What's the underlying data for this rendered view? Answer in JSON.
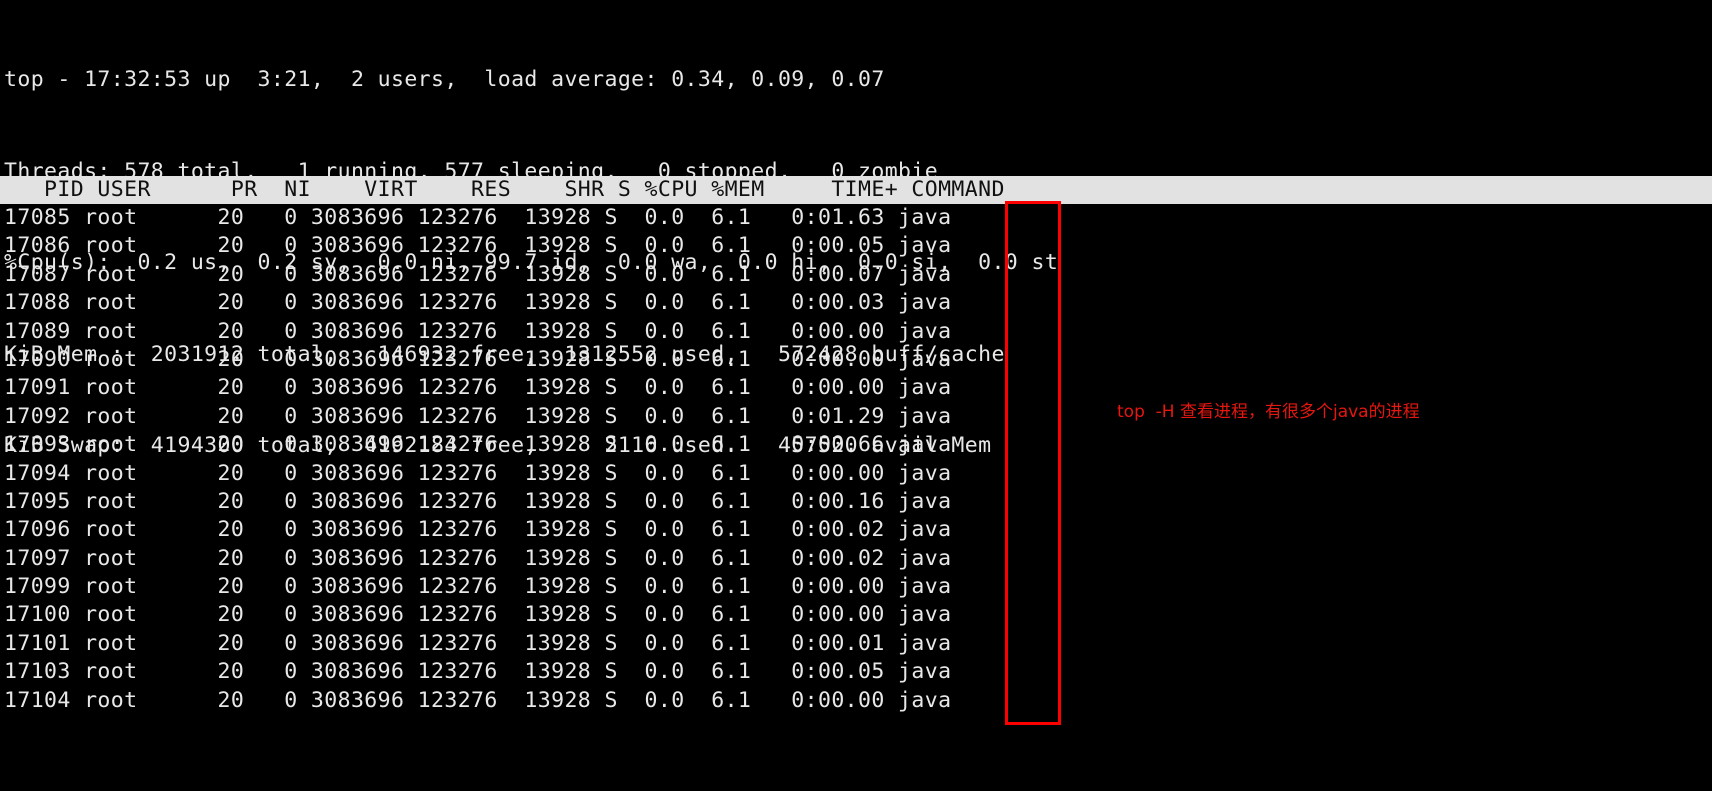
{
  "terminal": {
    "summary_lines": [
      "top - 17:32:53 up  3:21,  2 users,  load average: 0.34, 0.09, 0.07",
      "Threads: 578 total,   1 running, 577 sleeping,   0 stopped,   0 zombie",
      "%Cpu(s):  0.2 us,  0.2 sy,  0.0 ni, 99.7 id,  0.0 wa,  0.0 hi,  0.0 si,  0.0 st",
      "KiB Mem :  2031912 total,   146932 free,  1312552 used,   572428 buff/cache",
      "KiB Swap:  4194300 total,  4192184 free,     2116 used.   457520 avail Mem"
    ],
    "summary_detail": {
      "time": "17:32:53",
      "uptime": "3:21",
      "users": "2 users",
      "load_average": [
        "0.34",
        "0.09",
        "0.07"
      ],
      "threads": {
        "total": "578",
        "running": "1",
        "sleeping": "577",
        "stopped": "0",
        "zombie": "0"
      },
      "cpu": {
        "us": "0.2",
        "sy": "0.2",
        "ni": "0.0",
        "id": "99.7",
        "wa": "0.0",
        "hi": "0.0",
        "si": "0.0",
        "st": "0.0"
      },
      "mem": {
        "total": "2031912",
        "free": "146932",
        "used": "1312552",
        "buff_cache": "572428"
      },
      "swap": {
        "total": "4194300",
        "free": "4192184",
        "used": "2116",
        "avail_mem": "457520"
      }
    },
    "column_header": "   PID USER      PR  NI    VIRT    RES    SHR S %CPU %MEM     TIME+ COMMAND",
    "columns": [
      "PID",
      "USER",
      "PR",
      "NI",
      "VIRT",
      "RES",
      "SHR",
      "S",
      "%CPU",
      "%MEM",
      "TIME+",
      "COMMAND"
    ],
    "rows": [
      "17085 root      20   0 3083696 123276  13928 S  0.0  6.1   0:01.63 java",
      "17086 root      20   0 3083696 123276  13928 S  0.0  6.1   0:00.05 java",
      "17087 root      20   0 3083696 123276  13928 S  0.0  6.1   0:00.07 java",
      "17088 root      20   0 3083696 123276  13928 S  0.0  6.1   0:00.03 java",
      "17089 root      20   0 3083696 123276  13928 S  0.0  6.1   0:00.00 java",
      "17090 root      20   0 3083696 123276  13928 S  0.0  6.1   0:00.00 java",
      "17091 root      20   0 3083696 123276  13928 S  0.0  6.1   0:00.00 java",
      "17092 root      20   0 3083696 123276  13928 S  0.0  6.1   0:01.29 java",
      "17093 root      20   0 3083696 123276  13928 S  0.0  6.1   0:00.66 java",
      "17094 root      20   0 3083696 123276  13928 S  0.0  6.1   0:00.00 java",
      "17095 root      20   0 3083696 123276  13928 S  0.0  6.1   0:00.16 java",
      "17096 root      20   0 3083696 123276  13928 S  0.0  6.1   0:00.02 java",
      "17097 root      20   0 3083696 123276  13928 S  0.0  6.1   0:00.02 java",
      "17099 root      20   0 3083696 123276  13928 S  0.0  6.1   0:00.00 java",
      "17100 root      20   0 3083696 123276  13928 S  0.0  6.1   0:00.00 java",
      "17101 root      20   0 3083696 123276  13928 S  0.0  6.1   0:00.01 java",
      "17103 root      20   0 3083696 123276  13928 S  0.0  6.1   0:00.05 java",
      "17104 root      20   0 3083696 123276  13928 S  0.0  6.1   0:00.00 java"
    ],
    "rows_parsed": [
      {
        "pid": "17085",
        "user": "root",
        "pr": "20",
        "ni": "0",
        "virt": "3083696",
        "res": "123276",
        "shr": "13928",
        "s": "S",
        "cpu": "0.0",
        "mem": "6.1",
        "time": "0:01.63",
        "command": "java"
      },
      {
        "pid": "17086",
        "user": "root",
        "pr": "20",
        "ni": "0",
        "virt": "3083696",
        "res": "123276",
        "shr": "13928",
        "s": "S",
        "cpu": "0.0",
        "mem": "6.1",
        "time": "0:00.05",
        "command": "java"
      },
      {
        "pid": "17087",
        "user": "root",
        "pr": "20",
        "ni": "0",
        "virt": "3083696",
        "res": "123276",
        "shr": "13928",
        "s": "S",
        "cpu": "0.0",
        "mem": "6.1",
        "time": "0:00.07",
        "command": "java"
      },
      {
        "pid": "17088",
        "user": "root",
        "pr": "20",
        "ni": "0",
        "virt": "3083696",
        "res": "123276",
        "shr": "13928",
        "s": "S",
        "cpu": "0.0",
        "mem": "6.1",
        "time": "0:00.03",
        "command": "java"
      },
      {
        "pid": "17089",
        "user": "root",
        "pr": "20",
        "ni": "0",
        "virt": "3083696",
        "res": "123276",
        "shr": "13928",
        "s": "S",
        "cpu": "0.0",
        "mem": "6.1",
        "time": "0:00.00",
        "command": "java"
      },
      {
        "pid": "17090",
        "user": "root",
        "pr": "20",
        "ni": "0",
        "virt": "3083696",
        "res": "123276",
        "shr": "13928",
        "s": "S",
        "cpu": "0.0",
        "mem": "6.1",
        "time": "0:00.00",
        "command": "java"
      },
      {
        "pid": "17091",
        "user": "root",
        "pr": "20",
        "ni": "0",
        "virt": "3083696",
        "res": "123276",
        "shr": "13928",
        "s": "S",
        "cpu": "0.0",
        "mem": "6.1",
        "time": "0:00.00",
        "command": "java"
      },
      {
        "pid": "17092",
        "user": "root",
        "pr": "20",
        "ni": "0",
        "virt": "3083696",
        "res": "123276",
        "shr": "13928",
        "s": "S",
        "cpu": "0.0",
        "mem": "6.1",
        "time": "0:01.29",
        "command": "java"
      },
      {
        "pid": "17093",
        "user": "root",
        "pr": "20",
        "ni": "0",
        "virt": "3083696",
        "res": "123276",
        "shr": "13928",
        "s": "S",
        "cpu": "0.0",
        "mem": "6.1",
        "time": "0:00.66",
        "command": "java"
      },
      {
        "pid": "17094",
        "user": "root",
        "pr": "20",
        "ni": "0",
        "virt": "3083696",
        "res": "123276",
        "shr": "13928",
        "s": "S",
        "cpu": "0.0",
        "mem": "6.1",
        "time": "0:00.00",
        "command": "java"
      },
      {
        "pid": "17095",
        "user": "root",
        "pr": "20",
        "ni": "0",
        "virt": "3083696",
        "res": "123276",
        "shr": "13928",
        "s": "S",
        "cpu": "0.0",
        "mem": "6.1",
        "time": "0:00.16",
        "command": "java"
      },
      {
        "pid": "17096",
        "user": "root",
        "pr": "20",
        "ni": "0",
        "virt": "3083696",
        "res": "123276",
        "shr": "13928",
        "s": "S",
        "cpu": "0.0",
        "mem": "6.1",
        "time": "0:00.02",
        "command": "java"
      },
      {
        "pid": "17097",
        "user": "root",
        "pr": "20",
        "ni": "0",
        "virt": "3083696",
        "res": "123276",
        "shr": "13928",
        "s": "S",
        "cpu": "0.0",
        "mem": "6.1",
        "time": "0:00.02",
        "command": "java"
      },
      {
        "pid": "17099",
        "user": "root",
        "pr": "20",
        "ni": "0",
        "virt": "3083696",
        "res": "123276",
        "shr": "13928",
        "s": "S",
        "cpu": "0.0",
        "mem": "6.1",
        "time": "0:00.00",
        "command": "java"
      },
      {
        "pid": "17100",
        "user": "root",
        "pr": "20",
        "ni": "0",
        "virt": "3083696",
        "res": "123276",
        "shr": "13928",
        "s": "S",
        "cpu": "0.0",
        "mem": "6.1",
        "time": "0:00.00",
        "command": "java"
      },
      {
        "pid": "17101",
        "user": "root",
        "pr": "20",
        "ni": "0",
        "virt": "3083696",
        "res": "123276",
        "shr": "13928",
        "s": "S",
        "cpu": "0.0",
        "mem": "6.1",
        "time": "0:00.01",
        "command": "java"
      },
      {
        "pid": "17103",
        "user": "root",
        "pr": "20",
        "ni": "0",
        "virt": "3083696",
        "res": "123276",
        "shr": "13928",
        "s": "S",
        "cpu": "0.0",
        "mem": "6.1",
        "time": "0:00.05",
        "command": "java"
      },
      {
        "pid": "17104",
        "user": "root",
        "pr": "20",
        "ni": "0",
        "virt": "3083696",
        "res": "123276",
        "shr": "13928",
        "s": "S",
        "cpu": "0.0",
        "mem": "6.1",
        "time": "0:00.00",
        "command": "java"
      }
    ]
  },
  "annotation": {
    "text": "top  -H 查看进程，有很多个java的进程",
    "color": "#e61610"
  },
  "colors": {
    "background": "#000000",
    "foreground": "#e8e8e8",
    "header_bg": "#e2e2e2",
    "header_fg": "#101010",
    "highlight": "#ff0000"
  }
}
